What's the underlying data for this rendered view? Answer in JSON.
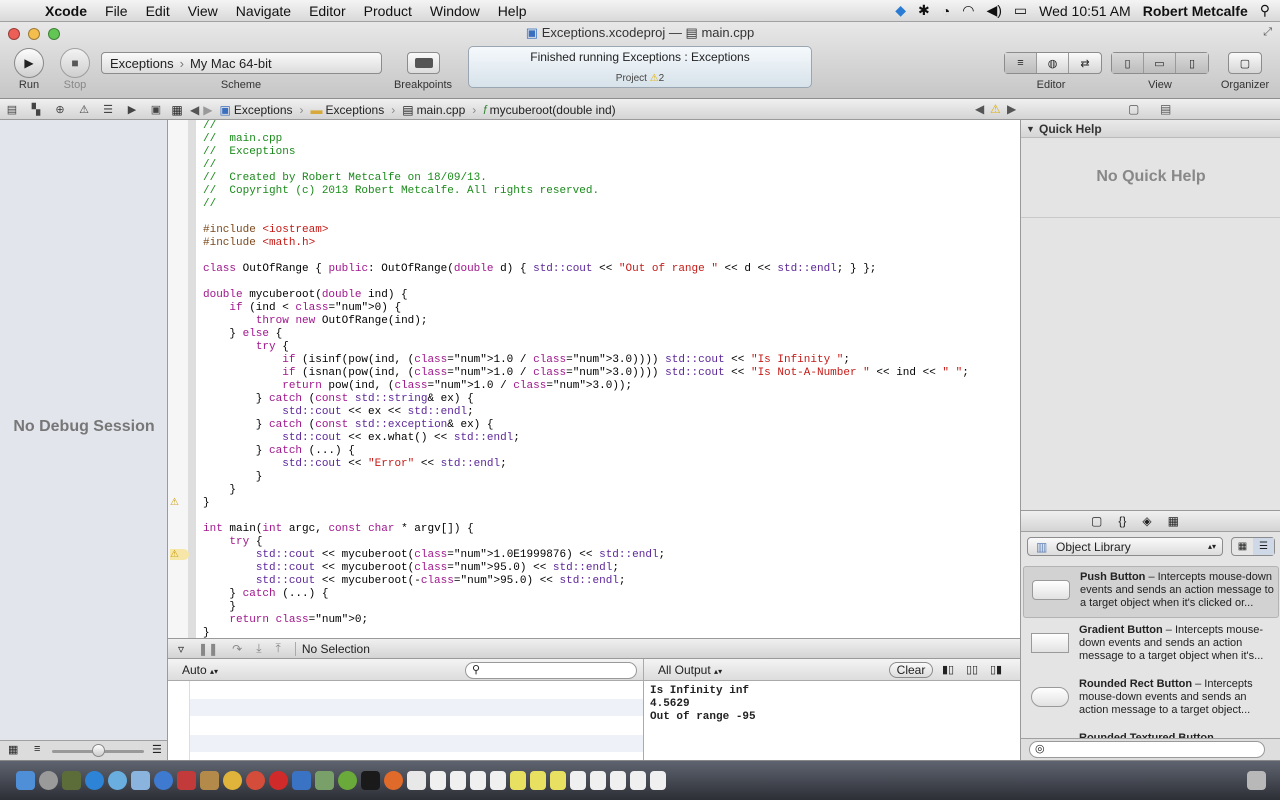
{
  "menubar": {
    "app": "Xcode",
    "items": [
      "File",
      "Edit",
      "View",
      "Navigate",
      "Editor",
      "Product",
      "Window",
      "Help"
    ],
    "clock": "Wed 10:51 AM",
    "user": "Robert Metcalfe"
  },
  "window": {
    "title_project": "Exceptions.xcodeproj",
    "title_sep": "—",
    "title_file": "main.cpp"
  },
  "toolbar": {
    "run_label": "Run",
    "stop_label": "Stop",
    "scheme_target": "Exceptions",
    "scheme_destination": "My Mac 64-bit",
    "scheme_label": "Scheme",
    "breakpoints_label": "Breakpoints",
    "activity_status": "Finished running Exceptions : Exceptions",
    "activity_project": "Project",
    "activity_warnings": "2",
    "editor_label": "Editor",
    "view_label": "View",
    "organizer_label": "Organizer"
  },
  "jumpbar": {
    "crumbs": [
      "Exceptions",
      "Exceptions",
      "main.cpp",
      "mycuberoot(double ind)"
    ]
  },
  "navigator": {
    "empty_message": "No Debug Session"
  },
  "editor": {
    "code_lines": [
      "//",
      "//  main.cpp",
      "//  Exceptions",
      "//",
      "//  Created by Robert Metcalfe on 18/09/13.",
      "//  Copyright (c) 2013 Robert Metcalfe. All rights reserved.",
      "//",
      "",
      "#include <iostream>",
      "#include <math.h>",
      "",
      "class OutOfRange { public: OutOfRange(double d) { std::cout << \"Out of range \" << d << std::endl; } };",
      "",
      "double mycuberoot(double ind) {",
      "    if (ind < 0) {",
      "        throw new OutOfRange(ind);",
      "    } else {",
      "        try {",
      "            if (isinf(pow(ind, (1.0 / 3.0)))) std::cout << \"Is Infinity \";",
      "            if (isnan(pow(ind, (1.0 / 3.0)))) std::cout << \"Is Not-A-Number \" << ind << \" \";",
      "            return pow(ind, (1.0 / 3.0));",
      "        } catch (const std::string& ex) {",
      "            std::cout << ex << std::endl;",
      "        } catch (const std::exception& ex) {",
      "            std::cout << ex.what() << std::endl;",
      "        } catch (...) {",
      "            std::cout << \"Error\" << std::endl;",
      "        }",
      "    }",
      "}",
      "",
      "int main(int argc, const char * argv[]) {",
      "    try {",
      "        std::cout << mycuberoot(1.0E1999876) << std::endl;",
      "        std::cout << mycuberoot(95.0) << std::endl;",
      "        std::cout << mycuberoot(-95.0) << std::endl;",
      "    } catch (...) {",
      "    }",
      "    return 0;",
      "}"
    ]
  },
  "debugbar": {
    "selection": "No Selection"
  },
  "debug_area": {
    "variables_scope": "Auto",
    "console_filter": "All Output",
    "clear_label": "Clear",
    "console_lines": [
      "Is Infinity inf",
      "4.5629",
      "Out of range -95"
    ]
  },
  "utilities": {
    "quick_help_title": "Quick Help",
    "quick_help_empty": "No Quick Help",
    "library_select": "Object Library",
    "library_items": [
      {
        "name": "Push Button",
        "desc": " – Intercepts mouse-down events and sends an action message to a target object when it's clicked or..."
      },
      {
        "name": "Gradient Button",
        "desc": " – Intercepts mouse-down events and sends an action message to a target object when it's..."
      },
      {
        "name": "Rounded Rect Button",
        "desc": " – Intercepts mouse-down events and sends an action message to a target object..."
      },
      {
        "name": "Rounded Textured Button",
        "desc": ""
      }
    ]
  },
  "colors": {
    "comment": "#1b8a1b",
    "keyword": "#a0168d",
    "string": "#c41a16",
    "number": "#1c00cf",
    "preprocessor": "#7d4a1e",
    "warning": "#e0b000"
  }
}
